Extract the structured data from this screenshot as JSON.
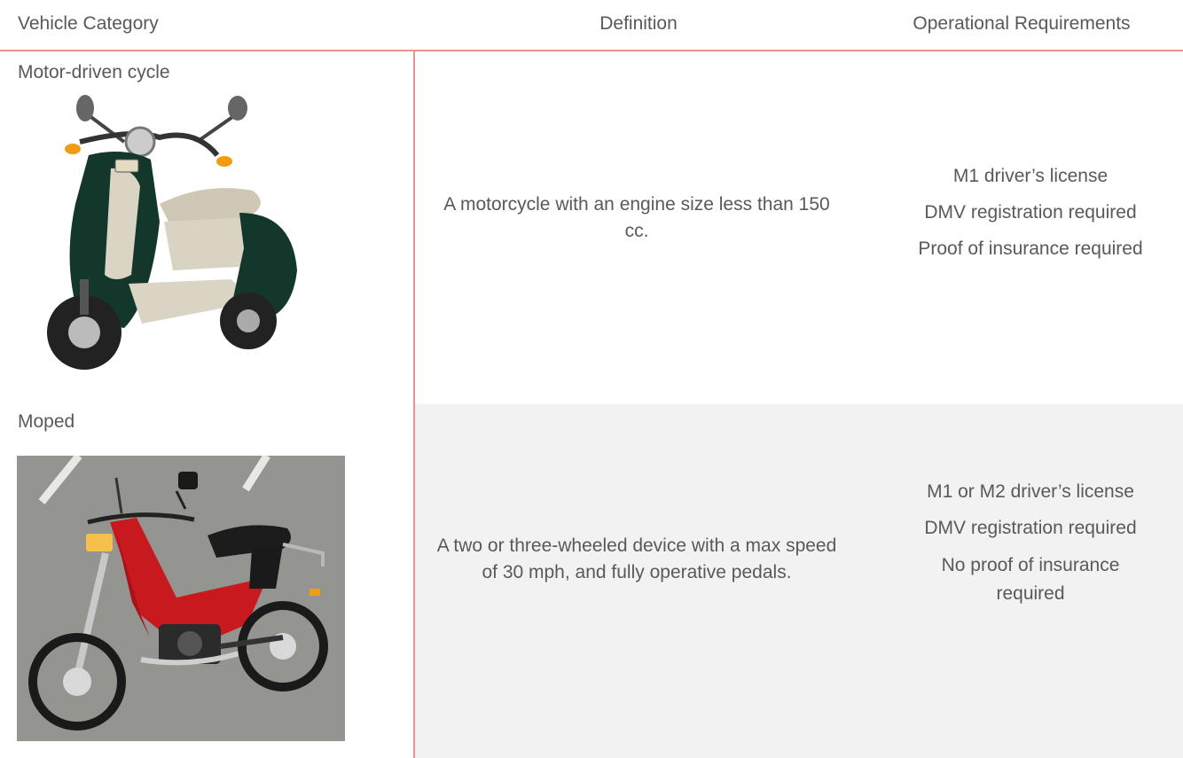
{
  "table": {
    "headers": {
      "category": "Vehicle Category",
      "definition": "Definition",
      "requirements": "Operational Requirements"
    },
    "rows": [
      {
        "category": "Motor-driven cycle",
        "image_icon": "scooter-photo",
        "definition": "A motorcycle with an engine size less than 150 cc.",
        "requirements": [
          "M1 driver’s license",
          "DMV registration required",
          "Proof of insurance required"
        ]
      },
      {
        "category": "Moped",
        "image_icon": "moped-photo",
        "definition": "A two or three-wheeled device with a max speed of 30 mph, and fully operative pedals.",
        "requirements": [
          "M1 or M2 driver’s license",
          "DMV registration required",
          "No proof of insurance required"
        ]
      }
    ]
  },
  "colors": {
    "accent_line": "#e8938b",
    "shaded_row": "#f2f2f2",
    "text": "#595959"
  }
}
